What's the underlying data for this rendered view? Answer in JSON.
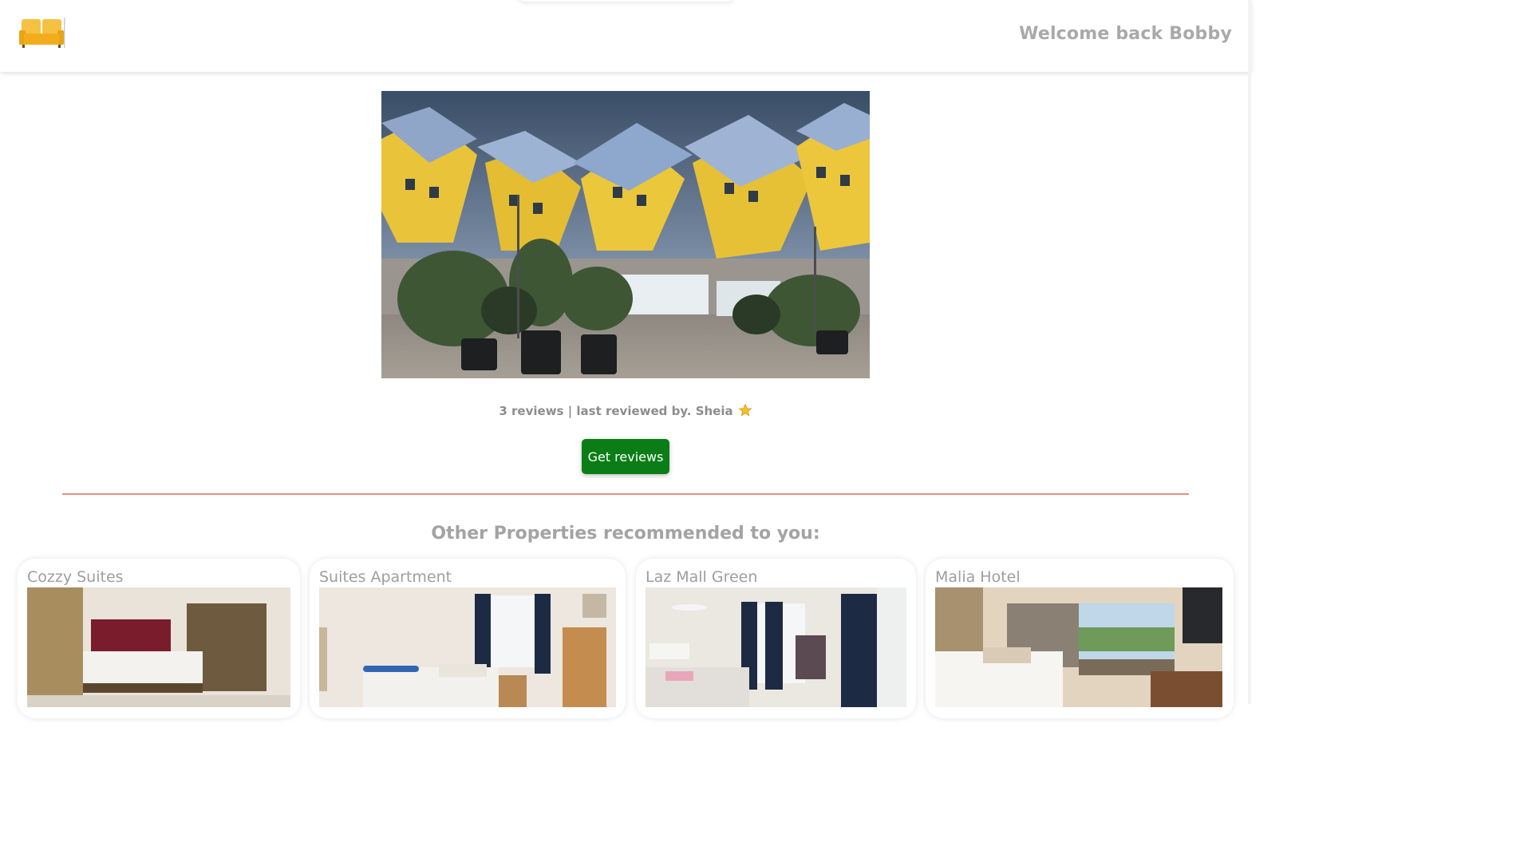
{
  "header": {
    "logo_icon": "sofa-icon",
    "welcome_text": "Welcome back Bobby"
  },
  "hero": {
    "image_subject": "yellow-cube-houses-photo"
  },
  "reviews": {
    "summary": "3 reviews | last reviewed by. Sheia",
    "rating_icon": "star-icon",
    "button_label": "Get reviews"
  },
  "recommendations": {
    "title": "Other Properties recommended to you:",
    "items": [
      {
        "name": "Cozzy Suites",
        "image": "bedroom-photo"
      },
      {
        "name": "Suites Apartment",
        "image": "bedroom-photo"
      },
      {
        "name": "Laz Mall Green",
        "image": "bedroom-photo"
      },
      {
        "name": "Malia Hotel",
        "image": "bedroom-photo"
      }
    ]
  },
  "colors": {
    "primary_button": "#0a7d16",
    "divider": "#e8907a",
    "logo": "#f5b82e",
    "muted_text": "#a3a3a3"
  }
}
